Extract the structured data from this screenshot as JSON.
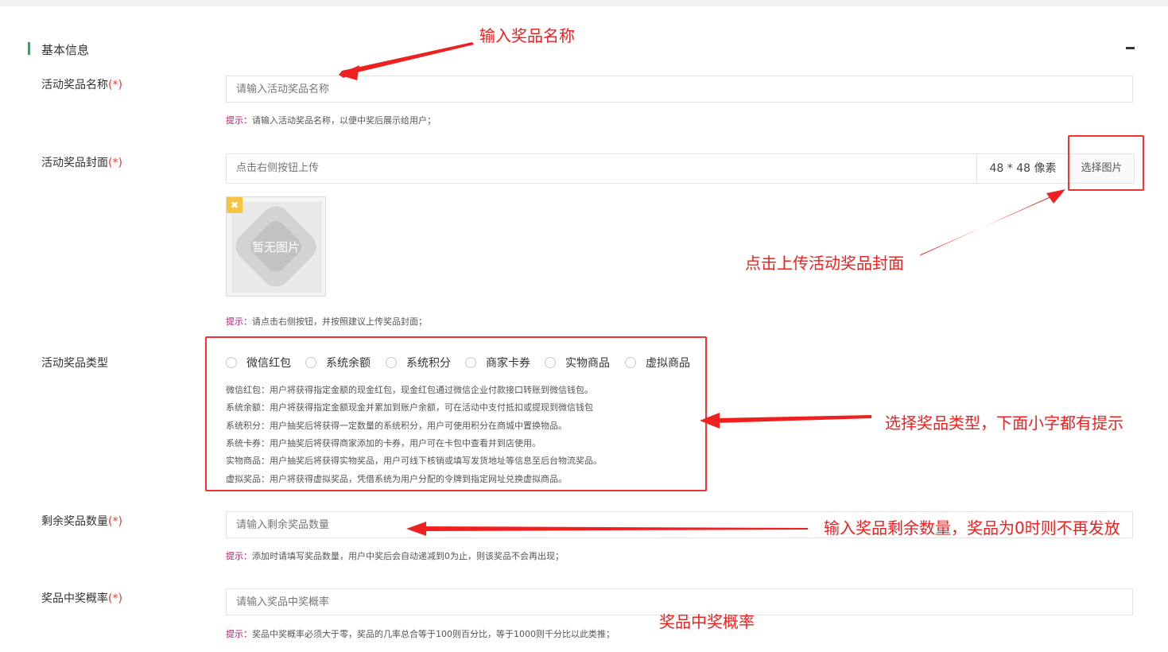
{
  "section": {
    "title": "基本信息"
  },
  "fields": {
    "name": {
      "label": "活动奖品名称",
      "required_mark": "(*)",
      "placeholder": "请输入活动奖品名称",
      "hint_key": "提示：",
      "hint_text": "请输入活动奖品名称，以便中奖后展示给用户；"
    },
    "cover": {
      "label": "活动奖品封面",
      "required_mark": "(*)",
      "placeholder": "点击右侧按钮上传",
      "size_text": "48 * 48 像素",
      "button_label": "选择图片",
      "thumb_text": "暂无图片",
      "hint_key": "提示：",
      "hint_text": "请点击右侧按钮，并按照建议上传奖品封面；"
    },
    "type": {
      "label": "活动奖品类型",
      "options": [
        "微信红包",
        "系统余额",
        "系统积分",
        "商家卡券",
        "实物商品",
        "虚拟商品"
      ],
      "descriptions": [
        "微信红包：用户将获得指定金额的现金红包，现金红包通过微信企业付款接口转账到微信钱包。",
        "系统余额：用户将获得指定金额现金并累加到账户余额，可在活动中支付抵扣或提现到微信钱包",
        "系统积分：用户抽奖后将获得一定数量的系统积分，用户可使用积分在商城中置换物品。",
        "系统卡券：用户抽奖后将获得商家添加的卡券，用户可在卡包中查看并到店使用。",
        "实物商品：用户抽奖后将获得实物奖品，用户可线下核销或填写发货地址等信息至后台物流奖品。",
        "虚拟奖品：用户将获得虚拟奖品，凭借系统为用户分配的令牌到指定网址兑换虚拟商品。"
      ]
    },
    "remaining": {
      "label": "剩余奖品数量",
      "required_mark": "(*)",
      "placeholder": "请输入剩余奖品数量",
      "hint_key": "提示：",
      "hint_text": "添加时请填写奖品数量，用户中奖后会自动递减到0为止，则该奖品不会再出现；"
    },
    "probability": {
      "label": "奖品中奖概率",
      "required_mark": "(*)",
      "placeholder": "请输入奖品中奖概率",
      "hint_key": "提示：",
      "hint_text": "奖品中奖概率必须大于零，奖品的几率总合等于100则百分比，等于1000则千分比以此类推；"
    }
  },
  "annotations": {
    "name": "输入奖品名称",
    "cover": "点击上传活动奖品封面",
    "type": "选择奖品类型，下面小字都有提示",
    "remaining": "输入奖品剩余数量，奖品为0时则不再发放",
    "probability": "奖品中奖概率"
  },
  "colors": {
    "accent_green": "#1ab35a",
    "required_red": "#e4393c",
    "hint_key": "#b01c6c",
    "annotation_red": "#f02020"
  }
}
